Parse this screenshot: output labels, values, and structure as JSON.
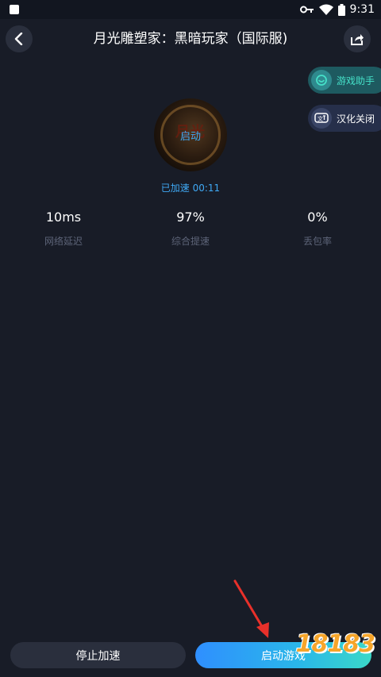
{
  "status_bar": {
    "time": "9:31",
    "icons": [
      "notification-square-icon",
      "key-icon",
      "wifi-icon",
      "battery-icon"
    ]
  },
  "header": {
    "title": "月光雕塑家：黑暗玩家（国际服)",
    "back_icon": "chevron-left-icon",
    "share_icon": "share-icon"
  },
  "side_buttons": {
    "assistant_label": "游戏助手",
    "chinese_label": "汉化关闭"
  },
  "game": {
    "avatar_overlay_label": "启动",
    "logo_text": "月光",
    "timer_text": "已加速 00:11"
  },
  "stats": [
    {
      "value": "10ms",
      "label": "网络延迟"
    },
    {
      "value": "97%",
      "label": "综合提速"
    },
    {
      "value": "0%",
      "label": "丢包率"
    }
  ],
  "bottom": {
    "stop_label": "停止加速",
    "start_label": "启动游戏"
  },
  "watermark": {
    "text": "18183"
  },
  "colors": {
    "background": "#181c27",
    "accent_blue": "#3fa9f5",
    "teal": "#45e0c8",
    "arrow_red": "#e8302a",
    "watermark_orange": "#f6a52a"
  }
}
